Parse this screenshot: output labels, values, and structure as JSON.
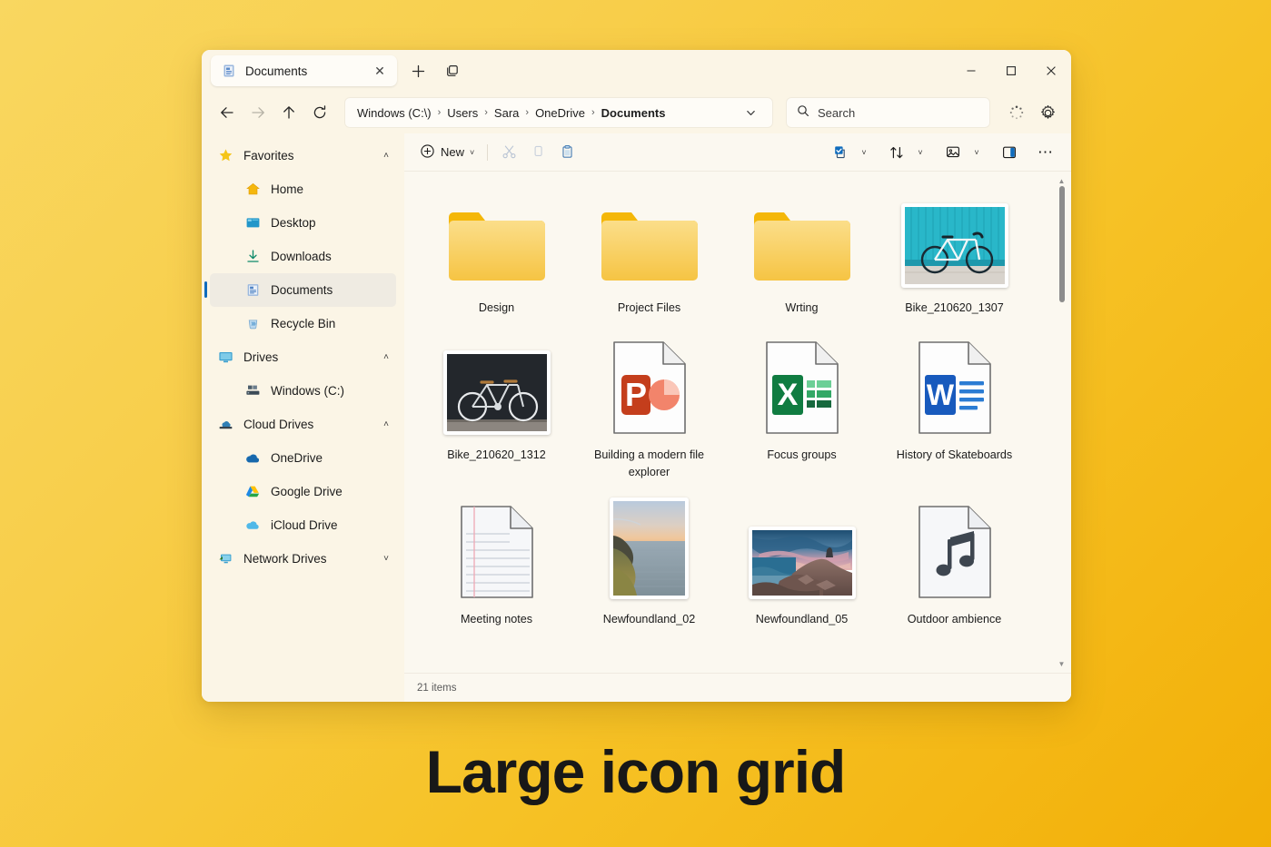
{
  "caption": "Large icon grid",
  "window": {
    "tab": {
      "title": "Documents",
      "icon": "documents-file-icon",
      "close_label": "✕"
    },
    "new_tab_label": "+",
    "tab_list_label": "tab-list",
    "controls": {
      "minimize": "—",
      "maximize": "□",
      "close": "✕"
    }
  },
  "nav": {
    "back": "back-arrow",
    "forward": "forward-arrow",
    "up": "up-arrow",
    "refresh": "refresh-arrow",
    "breadcrumbs": [
      {
        "label": "Windows (C:\\)",
        "current": false
      },
      {
        "label": "Users",
        "current": false
      },
      {
        "label": "Sara",
        "current": false
      },
      {
        "label": "OneDrive",
        "current": false
      },
      {
        "label": "Documents",
        "current": true
      }
    ],
    "separator": "›",
    "dropdown": "chevron-down-icon"
  },
  "search": {
    "placeholder": "Search"
  },
  "header_actions": {
    "loading": "loading-spinner",
    "settings": "gear-icon"
  },
  "sidebar": {
    "groups": [
      {
        "label": "Favorites",
        "icon": "star-icon",
        "expanded": true,
        "chevron": "˄",
        "items": [
          {
            "label": "Home",
            "icon": "home-icon",
            "selected": false
          },
          {
            "label": "Desktop",
            "icon": "desktop-icon",
            "selected": false
          },
          {
            "label": "Downloads",
            "icon": "download-icon",
            "selected": false
          },
          {
            "label": "Documents",
            "icon": "documents-icon",
            "selected": true
          },
          {
            "label": "Recycle Bin",
            "icon": "recycle-bin-icon",
            "selected": false
          }
        ]
      },
      {
        "label": "Drives",
        "icon": "monitor-icon",
        "expanded": true,
        "chevron": "˄",
        "items": [
          {
            "label": "Windows (C:)",
            "icon": "windows-drive-icon",
            "selected": false
          }
        ]
      },
      {
        "label": "Cloud Drives",
        "icon": "cloud-drive-icon",
        "expanded": true,
        "chevron": "˄",
        "items": [
          {
            "label": "OneDrive",
            "icon": "onedrive-icon",
            "selected": false
          },
          {
            "label": "Google Drive",
            "icon": "google-drive-icon",
            "selected": false
          },
          {
            "label": "iCloud Drive",
            "icon": "icloud-icon",
            "selected": false
          }
        ]
      },
      {
        "label": "Network Drives",
        "icon": "network-drive-icon",
        "expanded": false,
        "chevron": "˅",
        "items": []
      }
    ]
  },
  "toolbar": {
    "new_label": "New",
    "new_icon": "plus-circle-icon",
    "new_caret": "˅",
    "cut_icon": "scissors-icon",
    "copy_icon": "copy-icon",
    "paste_icon": "clipboard-paste-icon",
    "select_icon": "checkbox-select-icon",
    "select_caret": "˅",
    "sort_icon": "sort-arrows-icon",
    "sort_caret": "˅",
    "view_icon": "view-image-icon",
    "view_caret": "˅",
    "layout_icon": "details-pane-icon",
    "more_icon": "more-ellipsis-icon",
    "more_label": "⋯"
  },
  "files": [
    {
      "name": "Design",
      "type": "folder"
    },
    {
      "name": "Project Files",
      "type": "folder"
    },
    {
      "name": "Wrting",
      "type": "folder"
    },
    {
      "name": "Bike_210620_1307",
      "type": "photo-bike-teal"
    },
    {
      "name": "Bike_210620_1312",
      "type": "photo-bike-dark"
    },
    {
      "name": "Building a modern file explorer",
      "type": "powerpoint"
    },
    {
      "name": "Focus groups",
      "type": "excel"
    },
    {
      "name": "History of Skateboards",
      "type": "word"
    },
    {
      "name": "Meeting notes",
      "type": "notes"
    },
    {
      "name": "Newfoundland_02",
      "type": "photo-coast-sunset"
    },
    {
      "name": "Newfoundland_05",
      "type": "photo-rocks-dusk"
    },
    {
      "name": "Outdoor ambience",
      "type": "audio"
    }
  ],
  "status": {
    "items_text": "21 items"
  },
  "scrollbar": {
    "up": "▲",
    "down": "▼"
  },
  "colors": {
    "accent": "#0F6CBD",
    "folder": "#F7C948",
    "folder_tab": "#F2B705",
    "word": "#185ABD",
    "excel": "#107C41",
    "powerpoint": "#C43E1C",
    "background": "#F6C226",
    "window": "#FBF8F0"
  }
}
